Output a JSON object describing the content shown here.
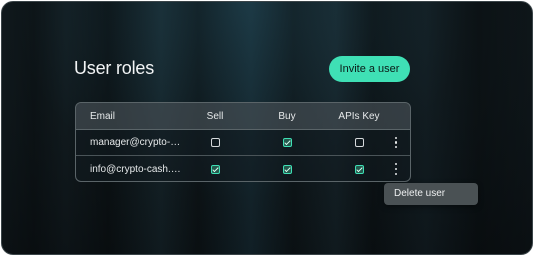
{
  "page": {
    "title": "User roles",
    "invite_label": "Invite a user"
  },
  "table": {
    "columns": [
      "Email",
      "Sell",
      "Buy",
      "APIs Key"
    ],
    "rows": [
      {
        "email": "manager@crypto-cas...",
        "sell": false,
        "buy": true,
        "api_key": false
      },
      {
        "email": "info@crypto-cash.wo...",
        "sell": true,
        "buy": true,
        "api_key": true
      }
    ]
  },
  "context_menu": {
    "items": [
      "Delete user"
    ]
  },
  "colors": {
    "accent": "#3fe0b5",
    "background": "#10191d"
  },
  "icons": {
    "row_menu": "more-vertical-icon",
    "checkbox": "checkbox-icon"
  }
}
